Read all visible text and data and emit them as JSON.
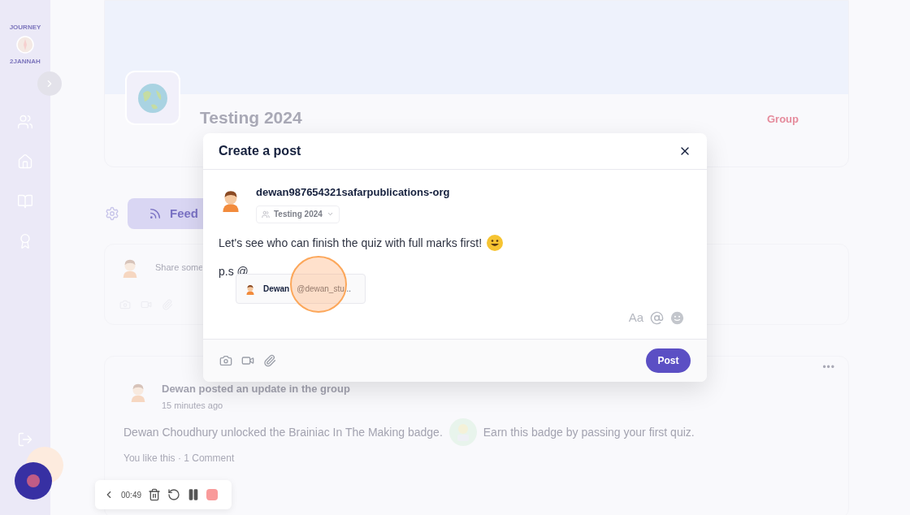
{
  "sidebar": {
    "logo_text": [
      "JOURNEY",
      "2JANNAH"
    ],
    "items": [
      {
        "kind": "groups"
      },
      {
        "kind": "home"
      },
      {
        "kind": "book"
      },
      {
        "kind": "award"
      }
    ],
    "bottom_item": {
      "kind": "logout"
    }
  },
  "group": {
    "title": "Testing 2024",
    "type_label": "Group"
  },
  "tabs": [
    {
      "label": "Feed",
      "selected": true
    }
  ],
  "composer": {
    "placeholder": "Share some"
  },
  "post": {
    "menu_label": "•••",
    "headline": "Dewan posted an update in the group",
    "time": "15 minutes ago",
    "body": "Dewan Choudhury unlocked the Brainiac In The Making badge.",
    "badge_note": "Earn this badge by passing your first quiz.",
    "stats": "You like this · 1 Comment"
  },
  "modal": {
    "title": "Create a post",
    "author": "dewan987654321safarpublications-org",
    "audience": "Testing 2024",
    "lines": [
      {
        "text": "Let's see who can finish the quiz with full marks first!",
        "trailing_emoji": true
      },
      {
        "text": "p.s @",
        "trailing_emoji": false
      }
    ],
    "mention": {
      "name": "Dewan",
      "handle": "@dewan_stu..."
    },
    "format_label": "Aa",
    "submit": "Post"
  },
  "recorder": {
    "time": "00:49"
  }
}
